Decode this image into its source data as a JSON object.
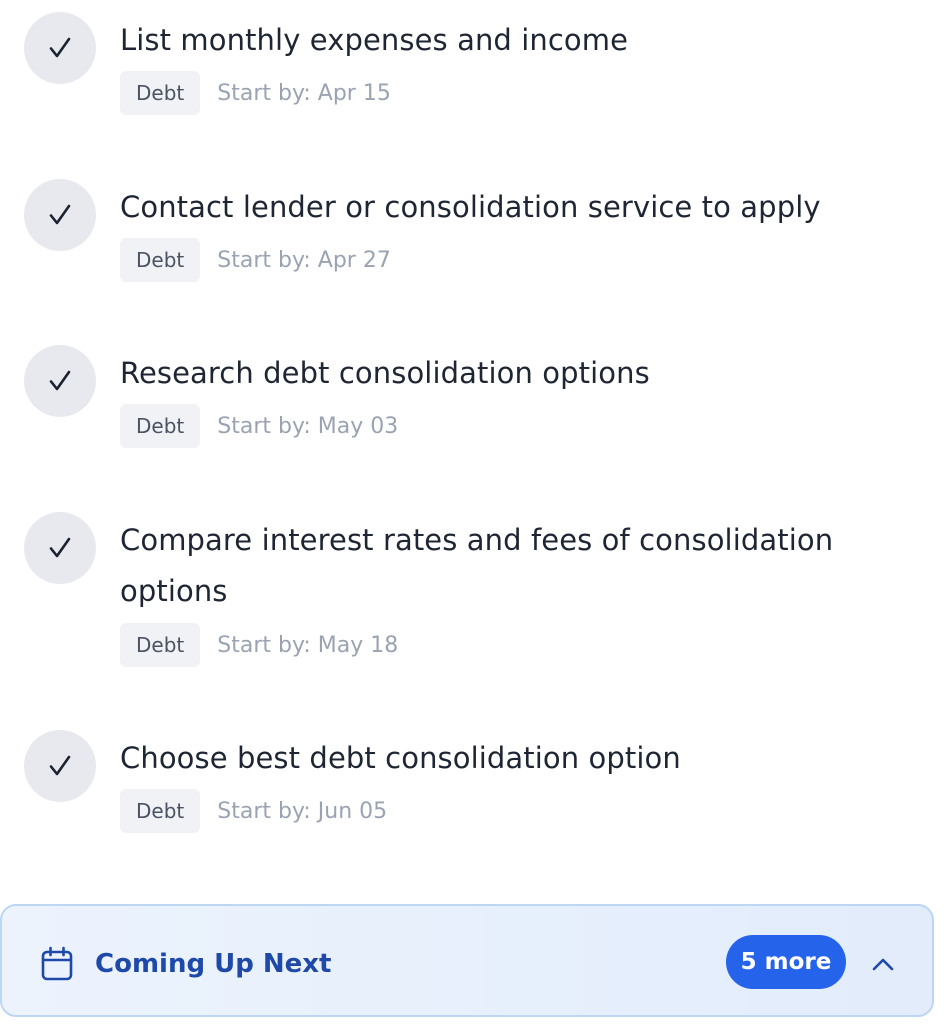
{
  "tasks": [
    {
      "title": "List monthly expenses and income",
      "tag": "Debt",
      "start": "Start by: Apr 15",
      "completed": true
    },
    {
      "title": "Contact lender or consolidation service to apply",
      "tag": "Debt",
      "start": "Start by: Apr 27",
      "completed": true
    },
    {
      "title": "Research debt consolidation options",
      "tag": "Debt",
      "start": "Start by: May 03",
      "completed": true
    },
    {
      "title": "Compare interest rates and fees of consolidation options",
      "tag": "Debt",
      "start": "Start by: May 18",
      "completed": true
    },
    {
      "title": "Choose best debt consolidation option",
      "tag": "Debt",
      "start": "Start by: Jun 05",
      "completed": true
    }
  ],
  "footer": {
    "title": "Coming Up Next",
    "badge": "5 more",
    "icon": "calendar-icon",
    "toggle_icon": "chevron-up-icon"
  },
  "colors": {
    "accent": "#2563eb",
    "footer_title": "#1e49a8",
    "check_bg": "#e7e9ee",
    "tag_bg": "#f0f2f6"
  }
}
